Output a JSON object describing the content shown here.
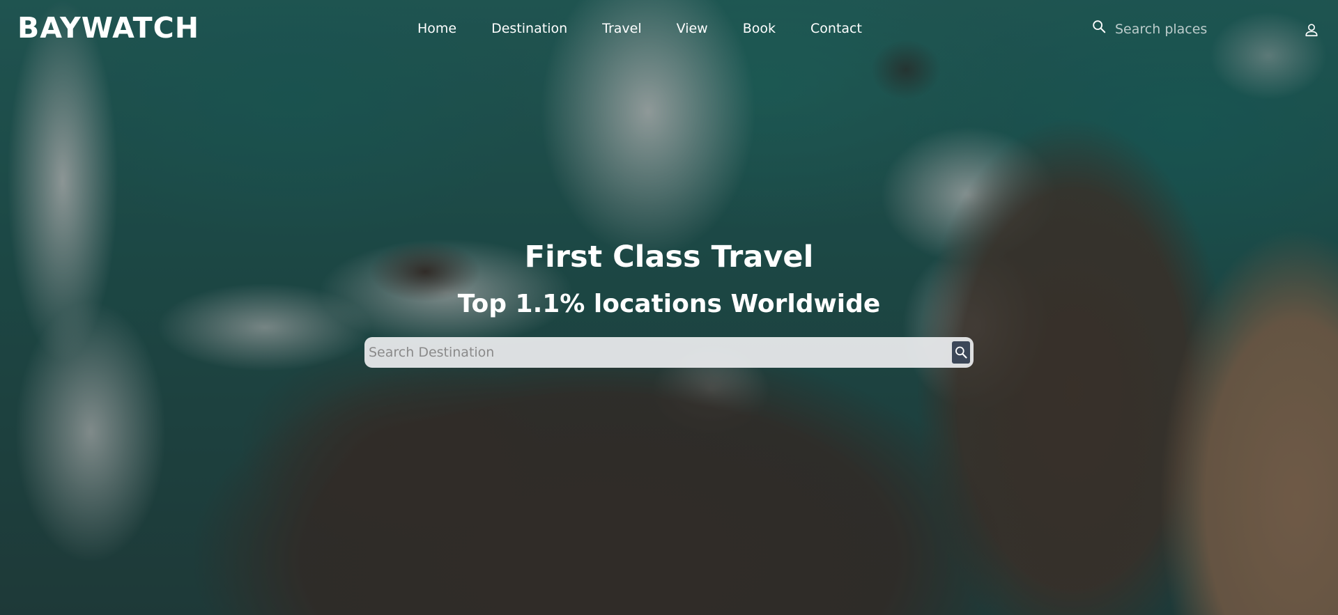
{
  "brand": {
    "logo": "BAYWATCH"
  },
  "nav": {
    "items": [
      {
        "label": "Home"
      },
      {
        "label": "Destination"
      },
      {
        "label": "Travel"
      },
      {
        "label": "View"
      },
      {
        "label": "Book"
      },
      {
        "label": "Contact"
      }
    ],
    "search": {
      "placeholder": "Search places",
      "icon": "search-icon"
    },
    "user_icon": "user-icon"
  },
  "hero": {
    "title": "First Class Travel",
    "subtitle": "Top 1.1% locations Worldwide",
    "search": {
      "placeholder": "Search Destination",
      "button_icon": "search-icon"
    }
  },
  "colors": {
    "text": "#ffffff",
    "search_bg": "#ebecee",
    "search_button": "#3c4758"
  }
}
